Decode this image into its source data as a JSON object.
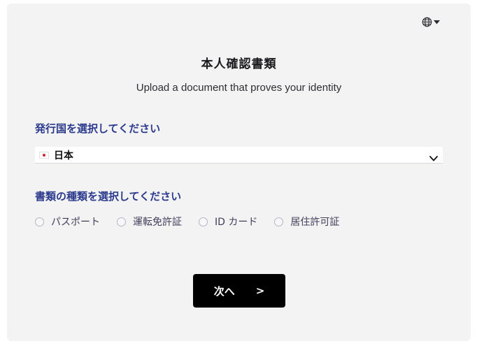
{
  "header": {
    "title": "本人確認書類",
    "subtitle": "Upload a document that proves your identity",
    "language_icon": "globe-icon"
  },
  "country": {
    "label": "発行国を選択してください",
    "selected": "日本",
    "flag_icon": "japan-flag-icon"
  },
  "document_type": {
    "label": "書類の種類を選択してください",
    "options": [
      {
        "label": "パスポート",
        "selected": false
      },
      {
        "label": "運転免許証",
        "selected": false
      },
      {
        "label": "ID カード",
        "selected": false
      },
      {
        "label": "居住許可証",
        "selected": false
      }
    ]
  },
  "actions": {
    "next_label": "次へ",
    "next_arrow": ">"
  },
  "colors": {
    "card_bg": "#f3f3f4",
    "label_blue": "#2b3a8c",
    "button_bg": "#000000",
    "flag_red": "#d3232e"
  }
}
